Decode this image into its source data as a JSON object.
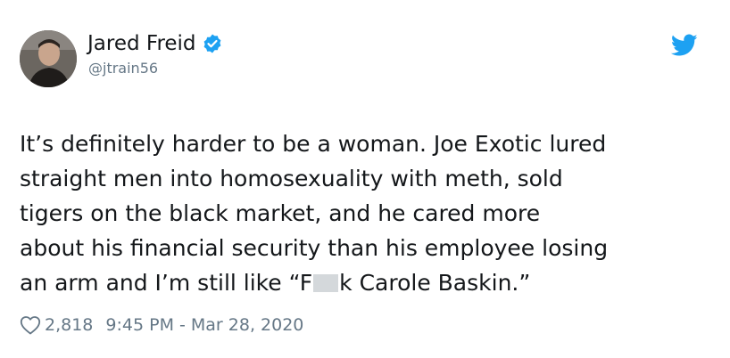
{
  "author": {
    "display_name": "Jared Freid",
    "handle": "@jtrain56",
    "verified": true
  },
  "tweet": {
    "lines": [
      "It’s definitely harder to be a woman. Joe Exotic lured",
      "straight men into homosexuality with meth, sold",
      "tigers on the black market, and he cared more",
      "about his financial security than his employee losing"
    ],
    "last_line_before_censor": "an arm and I’m still like “F",
    "last_line_after_censor": "k Carole Baskin.”"
  },
  "footer": {
    "like_count": "2,818",
    "timestamp": "9:45 PM - Mar 28, 2020"
  },
  "icons": {
    "verified": "verified-badge-icon",
    "platform": "twitter-bird-icon",
    "like": "heart-icon"
  },
  "colors": {
    "brand_blue": "#1da1f2",
    "text": "#14171a",
    "muted": "#657786"
  }
}
